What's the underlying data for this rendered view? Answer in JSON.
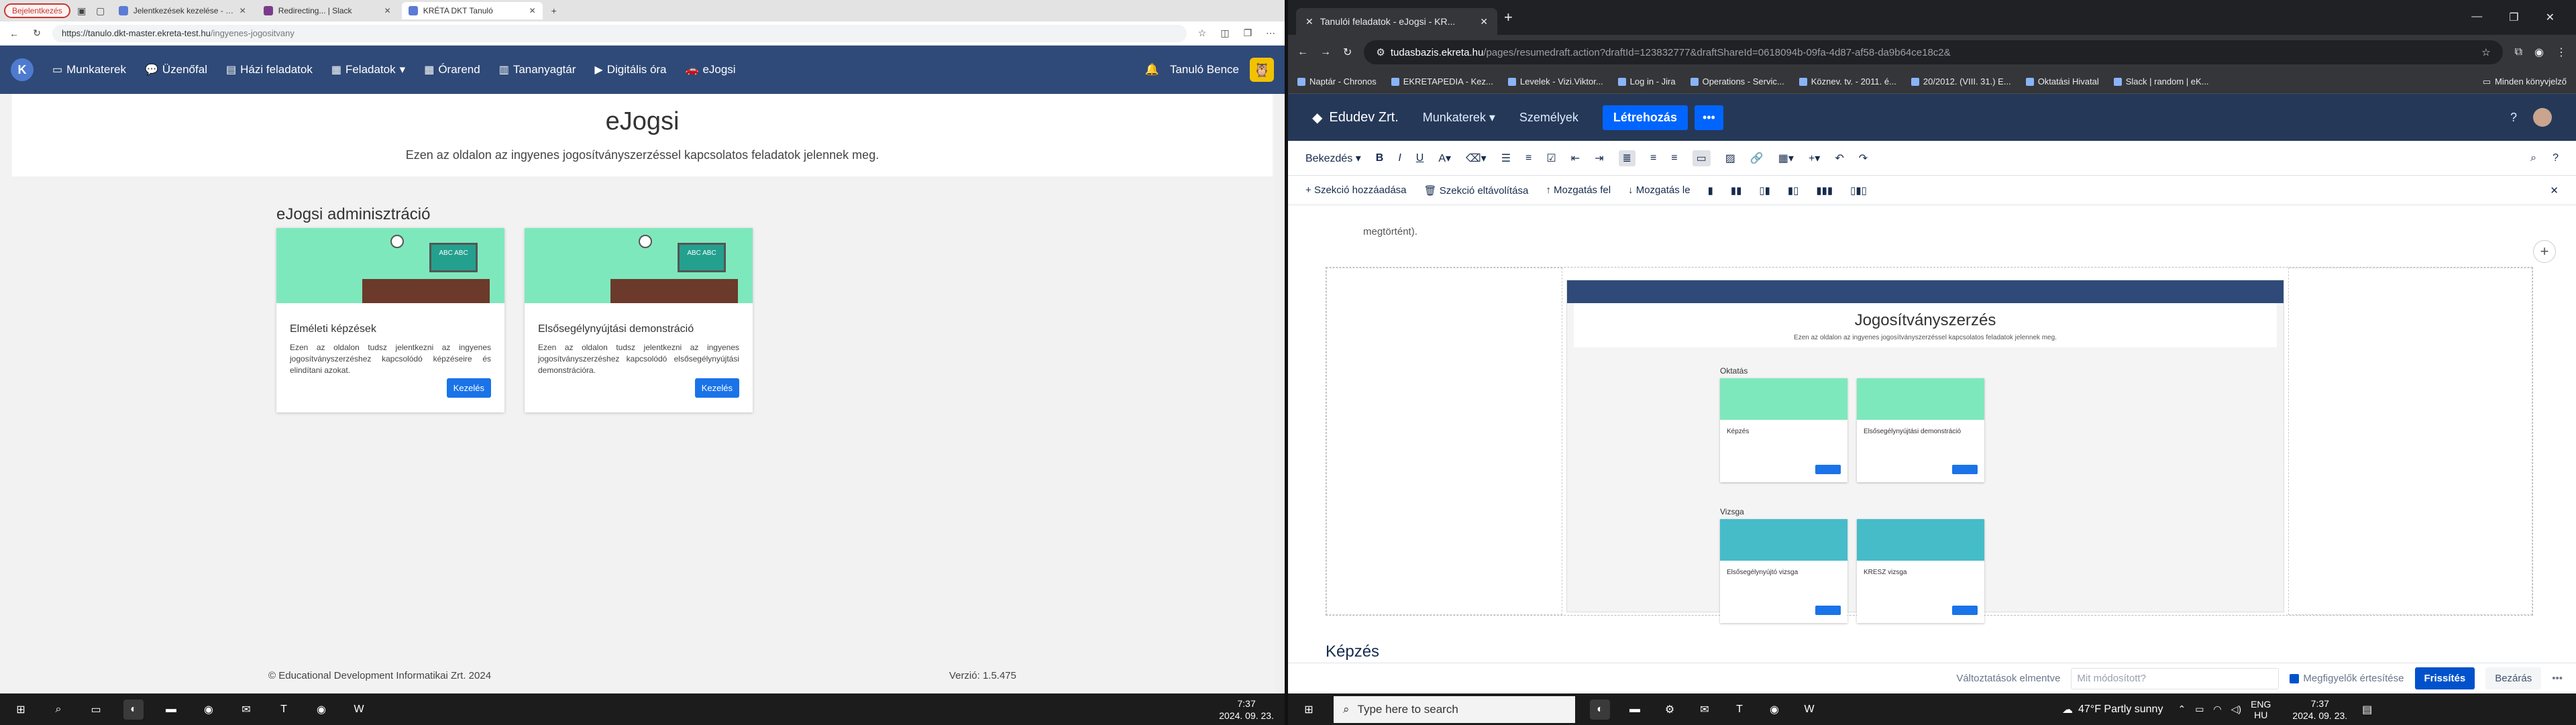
{
  "left_browser": {
    "profile": "Bejelentkezés",
    "tabs": [
      {
        "title": "Jelentkezések kezelése - eJogsi -"
      },
      {
        "title": "Redirecting... | Slack"
      },
      {
        "title": "KRÉTA DKT Tanuló"
      }
    ],
    "url_host": "https://tanulo.dkt-master.ekreta-test.hu",
    "url_path": "/ingyenes-jogositvany",
    "app_nav": {
      "items": [
        "Munkaterek",
        "Üzenőfal",
        "Házi feladatok",
        "Feladatok",
        "Órarend",
        "Tananyagtár",
        "Digitális óra",
        "eJogsi"
      ],
      "user": "Tanuló Bence"
    },
    "hero": {
      "title": "eJogsi",
      "subtitle": "Ezen az oldalon az ingyenes jogosítványszerzéssel kapcsolatos feladatok jelennek meg."
    },
    "section_title": "eJogsi adminisztráció",
    "cards": [
      {
        "title": "Elméleti képzések",
        "text": "Ezen az oldalon tudsz jelentkezni az ingyenes jogosítványszerzéshez kapcsolódó képzéseire és elindítani azokat.",
        "button": "Kezelés"
      },
      {
        "title": "Elsősegélynyújtási demonstráció",
        "text": "Ezen az oldalon tudsz jelentkezni az ingyenes jogosítványszerzéshez kapcsolódó elsősegélynyújtási demonstrációra.",
        "button": "Kezelés"
      }
    ],
    "board_text": "ABC ABC",
    "footer_left": "© Educational Development Informatikai Zrt. 2024",
    "footer_right": "Verzió: 1.5.475"
  },
  "right_browser": {
    "tab_title": "Tanulói feladatok - eJogsi - KR...",
    "url_host": "tudasbazis.ekreta.hu",
    "url_path": "/pages/resumedraft.action?draftId=123832777&draftShareId=0618094b-09fa-4d87-af58-da9b64ce18c2&",
    "bookmarks": [
      "Naptár - Chronos",
      "EKRETAPEDIA - Kez...",
      "Levelek - Vizi.Viktor...",
      "Log in - Jira",
      "Operations - Servic...",
      "Köznev. tv. - 2011. é...",
      "20/2012. (VIII. 31.) E...",
      "Oktatási Hivatal",
      "Slack | random | eK..."
    ],
    "other_bookmarks": "Minden könyvjelző",
    "conf_nav": {
      "brand": "Edudev Zrt.",
      "items": [
        "Munkaterek",
        "Személyek"
      ],
      "create": "Létrehozás",
      "more": "•••"
    },
    "toolbar1": {
      "paragraph": "Bekezdés"
    },
    "toolbar2": {
      "add_section": "Szekció hozzáadása",
      "remove_section": "Szekció eltávolítása",
      "move_up": "Mozgatás fel",
      "move_down": "Mozgatás le"
    },
    "body_text": "megtörtént).",
    "embed": {
      "title": "Jogosítványszerzés",
      "subtitle": "Ezen az oldalon az ingyenes jogosítványszerzéssel kapcsolatos feladatok jelennek meg.",
      "group1": "Oktatás",
      "group2": "Vizsga",
      "cards": [
        "Képzés",
        "Elsősegélynyújtási demonstráció",
        "Elsősegélynyújtó vizsga",
        "KRESZ vizsga"
      ]
    },
    "heading2": "Képzés",
    "bottom": {
      "changes_label": "Változtatások elmentve",
      "changes_placeholder": "Mit módosított?",
      "notify": "Megfigyelők értesítése",
      "refresh": "Frissítés",
      "close": "Bezárás",
      "more": "•••"
    }
  },
  "taskbar": {
    "left_time": "7:37",
    "left_date": "2024. 09. 23.",
    "search_placeholder": "Type here to search",
    "weather": "47°F  Partly sunny",
    "lang1": "ENG",
    "lang2": "HU",
    "right_time": "7:37",
    "right_date": "2024. 09. 23."
  }
}
